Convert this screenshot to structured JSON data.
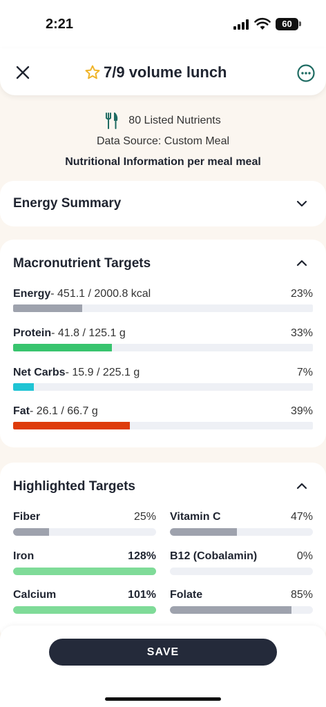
{
  "status_bar": {
    "time": "2:21",
    "battery": "60"
  },
  "header": {
    "title": "7/9 volume lunch",
    "close_icon": "close-icon",
    "star_icon": "star-outline-icon",
    "more_icon": "more-options-icon"
  },
  "info": {
    "nutrients": "80 Listed Nutrients",
    "source": "Data Source: Custom Meal",
    "per": "Nutritional Information per meal meal"
  },
  "energy_summary": {
    "title": "Energy Summary"
  },
  "macros": {
    "title": "Macronutrient Targets",
    "items": [
      {
        "name": "Energy",
        "detail": "- 451.1 / 2000.8 kcal",
        "pct": "23%",
        "fraction": 0.23,
        "color": "#9ea2ad"
      },
      {
        "name": "Protein",
        "detail": "- 41.8 / 125.1 g",
        "pct": "33%",
        "fraction": 0.33,
        "color": "#38c46e"
      },
      {
        "name": "Net Carbs",
        "detail": "- 15.9 / 225.1 g",
        "pct": "7%",
        "fraction": 0.07,
        "color": "#20c4d4"
      },
      {
        "name": "Fat",
        "detail": "- 26.1 / 66.7 g",
        "pct": "39%",
        "fraction": 0.39,
        "color": "#de3c0c"
      }
    ]
  },
  "highlighted": {
    "title": "Highlighted Targets",
    "items": [
      {
        "name": "Fiber",
        "pct": "25%",
        "fraction": 0.25,
        "color": "#9ea2ad",
        "strong": false
      },
      {
        "name": "Vitamin C",
        "pct": "47%",
        "fraction": 0.47,
        "color": "#9ea2ad",
        "strong": false
      },
      {
        "name": "Iron",
        "pct": "128%",
        "fraction": 1.0,
        "color": "#7fdb98",
        "strong": true
      },
      {
        "name": "B12 (Cobalamin)",
        "pct": "0%",
        "fraction": 0.0,
        "color": "#9ea2ad",
        "strong": false
      },
      {
        "name": "Calcium",
        "pct": "101%",
        "fraction": 1.0,
        "color": "#7fdb98",
        "strong": true
      },
      {
        "name": "Folate",
        "pct": "85%",
        "fraction": 0.85,
        "color": "#9ea2ad",
        "strong": false
      }
    ]
  },
  "footer": {
    "save_label": "SAVE"
  }
}
